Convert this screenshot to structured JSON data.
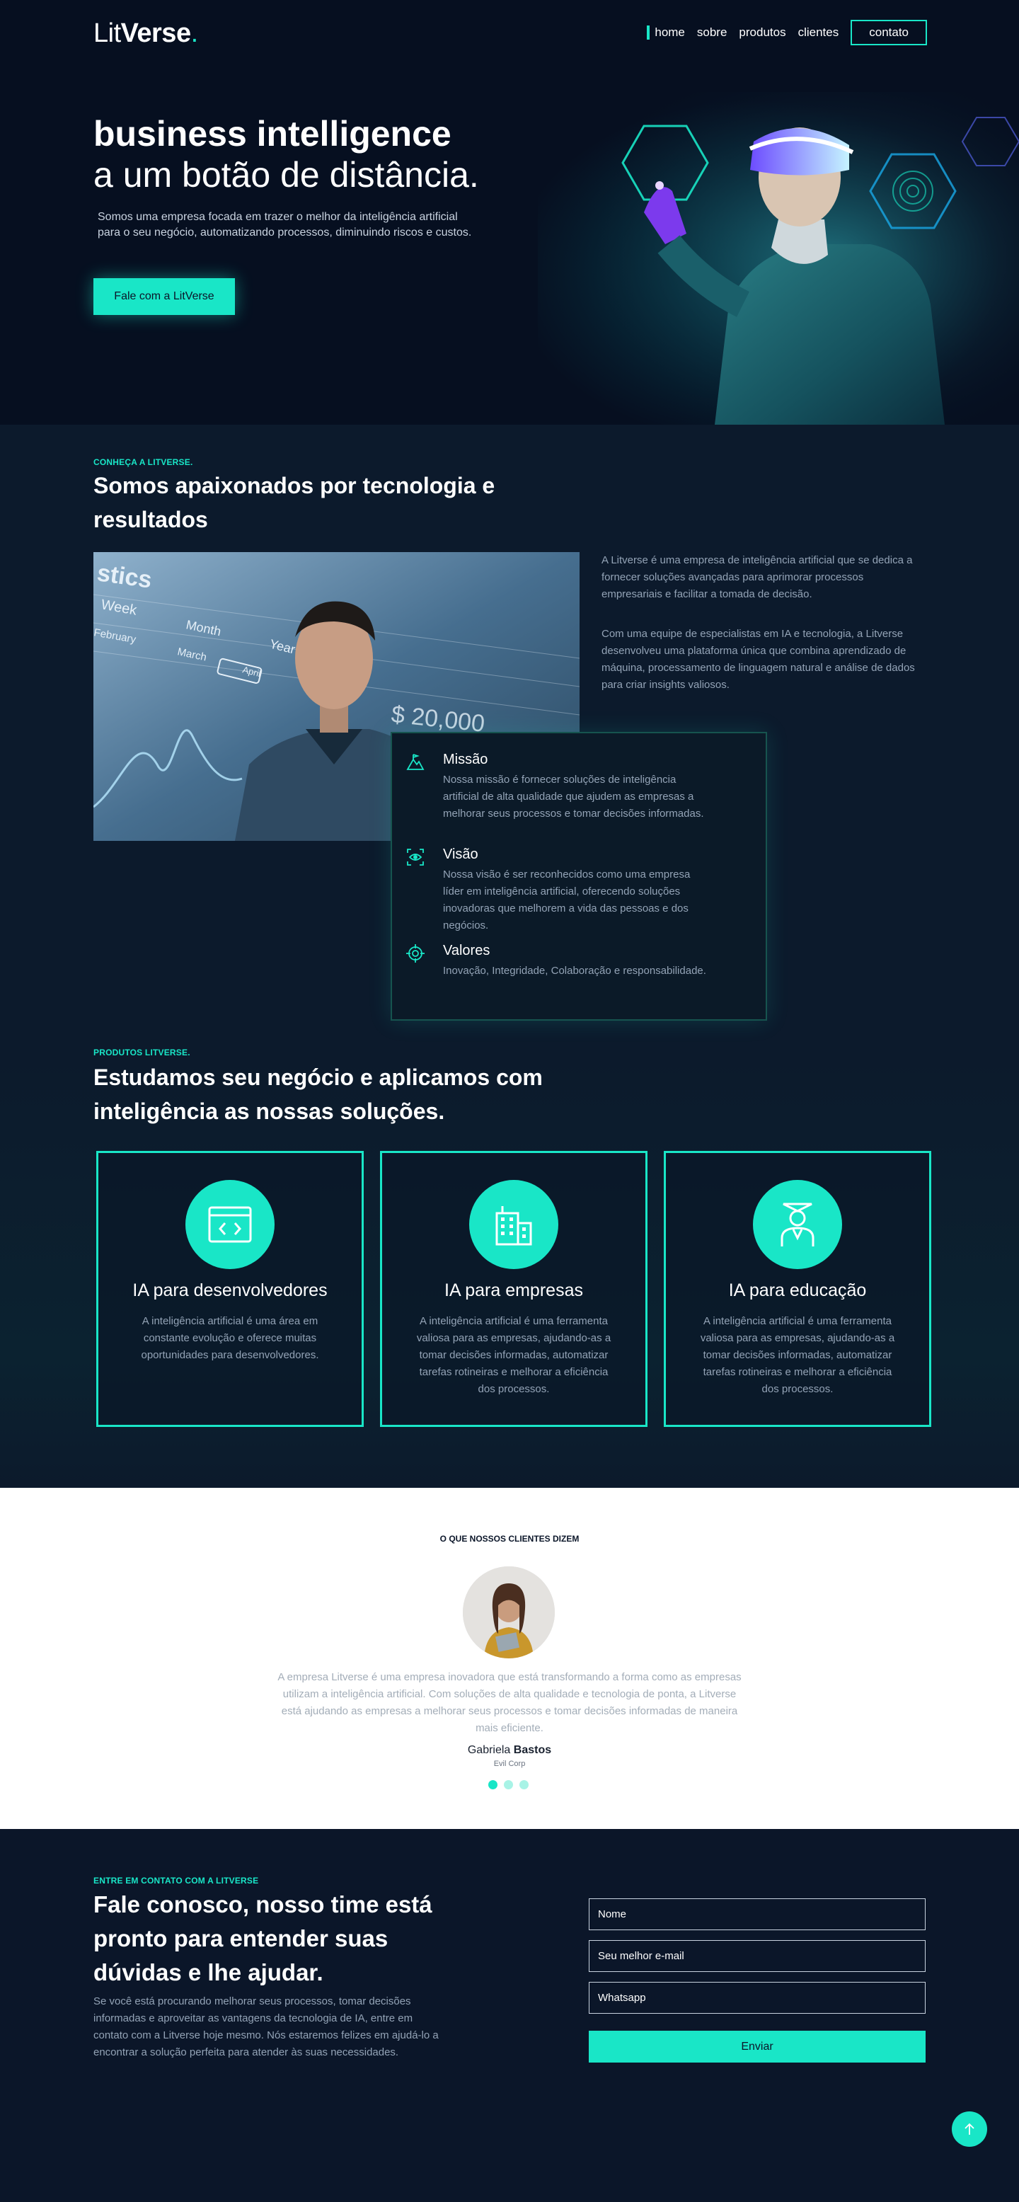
{
  "header": {
    "logo_light": "Lit",
    "logo_bold": "Verse",
    "logo_dot": ".",
    "nav": {
      "home": "home",
      "about": "sobre",
      "products": "produtos",
      "clients": "clientes",
      "contact": "contato"
    }
  },
  "hero": {
    "title_bold": "business intelligence",
    "title_light": "a um botão de distância.",
    "text": "Somos uma empresa focada em trazer o melhor da inteligência artificial para o seu negócio, automatizando processos, diminuindo riscos e custos.",
    "cta": "Fale com a LitVerse"
  },
  "about": {
    "eyebrow": "CONHEÇA A LITVERSE.",
    "title": "Somos apaixonados por tecnologia e resultados",
    "paragraph_1": "A Litverse é uma empresa de inteligência artificial que se dedica a fornecer soluções avançadas para aprimorar processos empresariais e facilitar a tomada de decisão.",
    "paragraph_2": "Com uma equipe de especialistas em IA e tecnologia, a Litverse desenvolveu uma plataforma única que combina aprendizado de máquina, processamento de linguagem natural e análise de dados para criar insights valiosos.",
    "photo_overlay": {
      "word_1": "stics",
      "word_2": "Week",
      "word_3": "Month",
      "word_4": "February",
      "word_5": "March",
      "word_6": "Year",
      "word_7": "April",
      "amount": "$ 20,000"
    },
    "mission": {
      "title": "Missão",
      "text": "Nossa missão é fornecer soluções de inteligência artificial de alta qualidade que ajudem as empresas a melhorar seus processos e tomar decisões informadas."
    },
    "vision": {
      "title": "Visão",
      "text": "Nossa visão é ser reconhecidos como uma empresa líder em inteligência artificial, oferecendo soluções inovadoras que melhorem a vida das pessoas e dos negócios."
    },
    "values": {
      "title": "Valores",
      "text": "Inovação, Integridade, Colaboração e responsabilidade."
    }
  },
  "products": {
    "eyebrow": "PRODUTOS LITVERSE.",
    "title": "Estudamos seu negócio e aplicamos com inteligência as nossas soluções.",
    "cards": [
      {
        "icon": "code-window-icon",
        "title": "IA para desenvolvedores",
        "text": "A inteligência artificial é uma área em constante evolução e oferece muitas oportunidades para desenvolvedores."
      },
      {
        "icon": "buildings-icon",
        "title": "IA para empresas",
        "text": "A inteligência artificial é uma ferramenta valiosa para as empresas, ajudando-as a tomar decisões informadas, automatizar tarefas rotineiras e melhorar a eficiência dos processos."
      },
      {
        "icon": "graduate-icon",
        "title": "IA para educação",
        "text": "A inteligência artificial é uma ferramenta valiosa para as empresas, ajudando-as a tomar decisões informadas, automatizar tarefas rotineiras e melhorar a eficiência dos processos."
      }
    ]
  },
  "testimonial": {
    "eyebrow": "O QUE NOSSOS CLIENTES DIZEM",
    "quote": "A empresa Litverse é uma empresa inovadora que está transformando a forma como as empresas utilizam a inteligência artificial. Com soluções de alta qualidade e tecnologia de ponta, a Litverse está ajudando as empresas a melhorar seus processos e tomar decisões informadas de maneira mais eficiente.",
    "author_first": "Gabriela",
    "author_last": "Bastos",
    "company": "Evil Corp",
    "slides": 3,
    "active_slide": 1
  },
  "contact": {
    "eyebrow": "ENTRE EM CONTATO COM A LITVERSE",
    "title": "Fale conosco, nosso time está pronto para entender suas dúvidas e lhe ajudar.",
    "text": "Se você está procurando melhorar seus processos, tomar decisões informadas e aproveitar as vantagens da tecnologia de IA, entre em contato com a Litverse hoje mesmo. Nós estaremos felizes em ajudá-lo a encontrar a solução perfeita para atender às suas necessidades.",
    "name_placeholder": "Nome",
    "email_placeholder": "Seu melhor e-mail",
    "whatsapp_placeholder": "Whatsapp",
    "submit": "Enviar"
  },
  "colors": {
    "accent": "#19e6c7",
    "background": "#0b1629",
    "muted_text": "#93a3b6"
  }
}
